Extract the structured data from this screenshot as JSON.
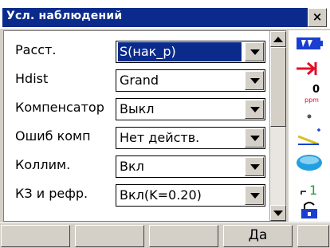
{
  "window": {
    "title": "Усл. наблюдений",
    "close_label": "×"
  },
  "settings": [
    {
      "label": "Расст.",
      "value": "S(нак_р)",
      "selected": true
    },
    {
      "label": "Hdist",
      "value": "Grand",
      "selected": false
    },
    {
      "label": "Компенсатор",
      "value": "Выкл",
      "selected": false
    },
    {
      "label": "Ошиб комп",
      "value": "Нет действ.",
      "selected": false
    },
    {
      "label": "Коллим.",
      "value": "Вкл",
      "selected": false
    },
    {
      "label": "КЗ и рефр.",
      "value": "Вкл(K=0.20)",
      "selected": false
    }
  ],
  "status_icons": [
    {
      "name": "battery-icon"
    },
    {
      "name": "target-arrow-icon"
    },
    {
      "name": "ppm-icon",
      "text": "0",
      "unit": "ppm"
    },
    {
      "name": "dot-icon"
    },
    {
      "name": "tilt-icon"
    },
    {
      "name": "disk-icon"
    },
    {
      "name": "signal-icon",
      "text": "1"
    },
    {
      "name": "lock-icon"
    }
  ],
  "softkeys": [
    "",
    "",
    "",
    "Да",
    ""
  ],
  "colors": {
    "title_bar": "#0a2b8c",
    "selection": "#0a2b8c",
    "battery": "#1a3fd0",
    "arrow": "#e0102a",
    "disk": "#20a0e0",
    "tilt": "#d8c020"
  }
}
